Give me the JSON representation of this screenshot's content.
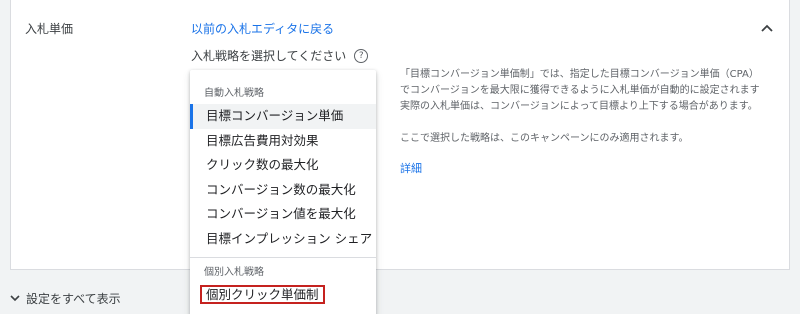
{
  "section": {
    "label": "入札単価",
    "back_link": "以前の入札エディタに戻る",
    "strategy_prompt": "入札戦略を選択してください"
  },
  "icons": {
    "collapse": "chevron-up-icon",
    "help": "help-icon",
    "expand": "chevron-down-icon"
  },
  "dropdown": {
    "auto_group": {
      "title": "自動入札戦略",
      "items": [
        "目標コンバージョン単価",
        "目標広告費用対効果",
        "クリック数の最大化",
        "コンバージョン数の最大化",
        "コンバージョン値を最大化",
        "目標インプレッション シェア"
      ],
      "selected_index": 0
    },
    "manual_group": {
      "title": "個別入札戦略",
      "items": [
        "個別クリック単価制"
      ]
    }
  },
  "description": {
    "line1": "「目標コンバージョン単価制」では、指定した目標コンバージョン単価（CPA）",
    "line2": "でコンバージョンを最大限に獲得できるように入札単価が自動的に設定されます",
    "line3": "実際の入札単価は、コンバージョンによって目標より上下する場合があります。",
    "line4": "ここで選択した戦略は、このキャンペーンにのみ適用されます。",
    "detail_link": "詳細"
  },
  "footer": {
    "show_all": "設定をすべて表示"
  },
  "colors": {
    "accent": "#1a73e8",
    "highlight_border": "#c5221f"
  }
}
